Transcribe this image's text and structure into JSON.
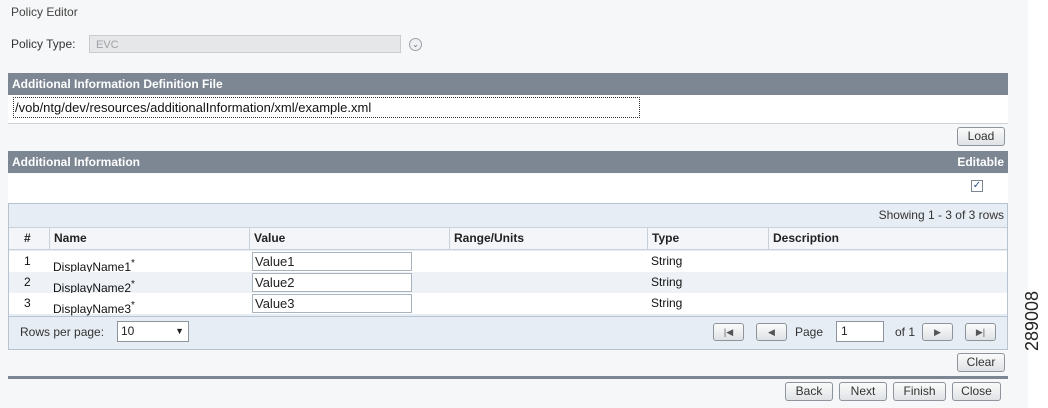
{
  "page": {
    "title": "Policy Editor"
  },
  "policy_type": {
    "label": "Policy Type:",
    "value": "EVC"
  },
  "definition_file": {
    "header": "Additional Information Definition File",
    "path": "/vob/ntg/dev/resources/additionalInformation/xml/example.xml",
    "load_label": "Load"
  },
  "additional_info": {
    "header": "Additional Information",
    "editable_label": "Editable",
    "editable_checked": true,
    "showing_text": "Showing 1 - 3 of 3 rows",
    "columns": [
      "#",
      "Name",
      "Value",
      "Range/Units",
      "Type",
      "Description"
    ],
    "rows": [
      {
        "num": "1",
        "name": "DisplayName1",
        "required": "*",
        "value": "Value1",
        "range": "",
        "type": "String",
        "description": ""
      },
      {
        "num": "2",
        "name": "DisplayName2",
        "required": "*",
        "value": "Value2",
        "range": "",
        "type": "String",
        "description": ""
      },
      {
        "num": "3",
        "name": "DisplayName3",
        "required": "*",
        "value": "Value3",
        "range": "",
        "type": "String",
        "description": ""
      }
    ],
    "pager": {
      "rows_per_page_label": "Rows per page:",
      "rows_per_page_value": "10",
      "page_label": "Page",
      "page_value": "1",
      "of_label": "of 1"
    },
    "clear_label": "Clear"
  },
  "footer": {
    "back": "Back",
    "next": "Next",
    "finish": "Finish",
    "close": "Close"
  },
  "side_id": "289008"
}
